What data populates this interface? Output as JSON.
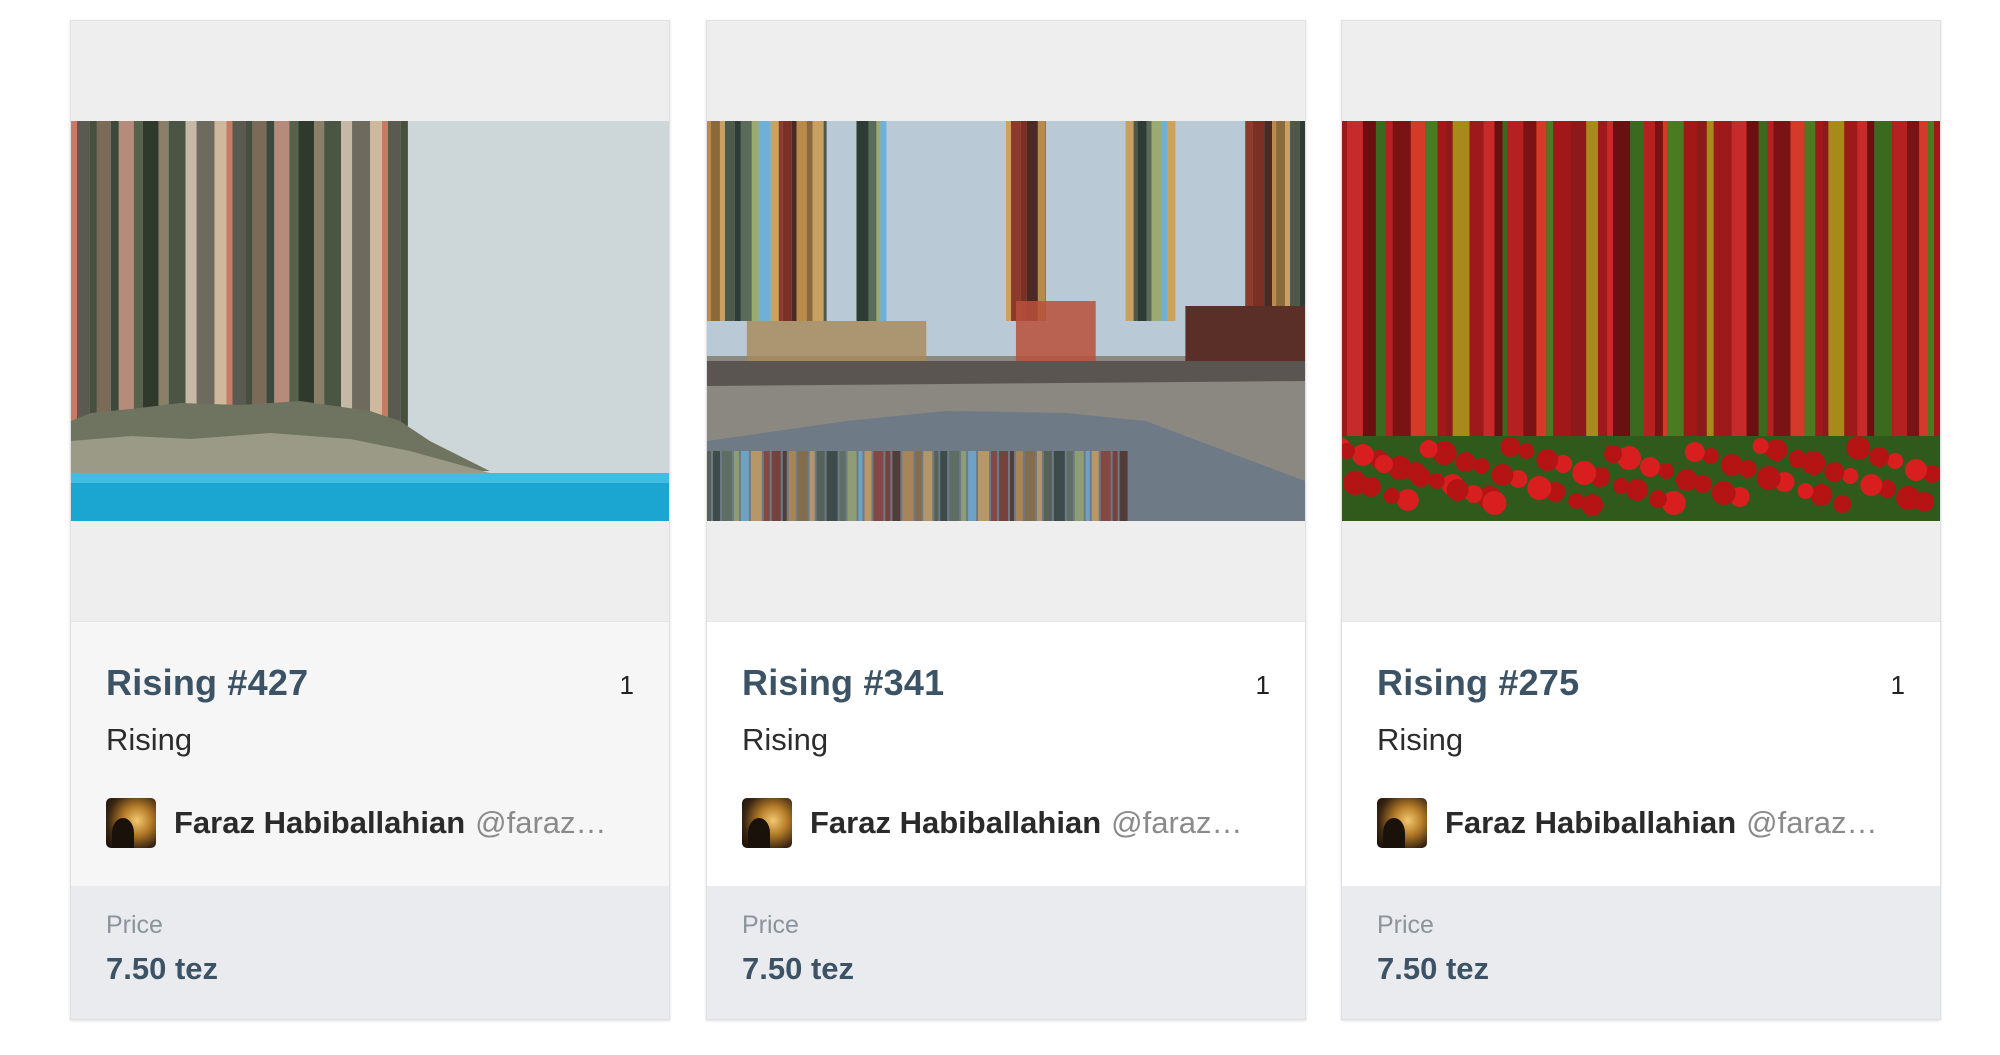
{
  "cards": [
    {
      "title": "Rising #427",
      "edition": "1",
      "subtitle": "Rising",
      "creator_name": "Faraz Habiballahian",
      "creator_handle": "@faraz…",
      "price_label": "Price",
      "price_value": "7.50 tez",
      "artwork_scene": "coastal-cliff-sea",
      "stripe_colors": [
        "#c97a63",
        "#5a5a50",
        "#47503e",
        "#7b6a58",
        "#3d4a3a",
        "#b78b7a",
        "#56624a",
        "#2f3a2d",
        "#8c7f68",
        "#4a5643",
        "#c7b7a6",
        "#6f6a5e",
        "#d0b89c"
      ]
    },
    {
      "title": "Rising #341",
      "edition": "1",
      "subtitle": "Rising",
      "creator_name": "Faraz Habiballahian",
      "creator_handle": "@faraz…",
      "price_label": "Price",
      "price_value": "7.50 tez",
      "artwork_scene": "red-square-reflection",
      "stripe_colors": [
        "#b98a4a",
        "#8a6a3a",
        "#c9a060",
        "#4d5a4a",
        "#2f3c36",
        "#5a6b5a",
        "#9aaa70",
        "#6fb0d9",
        "#cfa25a",
        "#8c3a2e",
        "#7a3025",
        "#4a2a22"
      ]
    },
    {
      "title": "Rising #275",
      "edition": "1",
      "subtitle": "Rising",
      "creator_name": "Faraz Habiballahian",
      "creator_handle": "@faraz…",
      "price_label": "Price",
      "price_value": "7.50 tez",
      "artwork_scene": "red-tulip-field",
      "stripe_colors": [
        "#9e1a1a",
        "#c72a2a",
        "#6b1010",
        "#3a6a1e",
        "#b52020",
        "#7a1414",
        "#d33a2a",
        "#4a7a22",
        "#a01818",
        "#8c1a1a",
        "#a88a1a"
      ]
    }
  ]
}
